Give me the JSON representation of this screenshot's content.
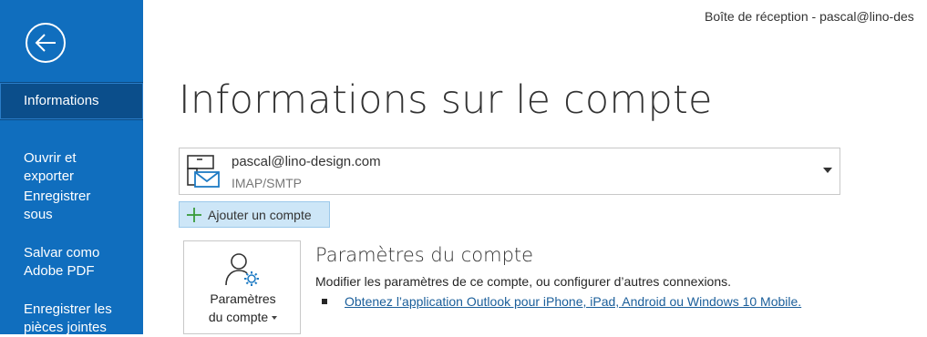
{
  "window": {
    "title": "Boîte de réception - pascal@lino-des"
  },
  "sidebar": {
    "back_icon": "back-arrow-icon",
    "items": [
      {
        "label": "Informations",
        "active": true
      },
      {
        "label": "Ouvrir et\nexporter"
      },
      {
        "label": "Enregistrer sous"
      },
      {
        "label": "Salvar como\nAdobe PDF"
      },
      {
        "label": "Enregistrer les\npièces jointes"
      }
    ]
  },
  "main": {
    "title": "Informations sur le compte",
    "account": {
      "email": "pascal@lino-design.com",
      "type": "IMAP/SMTP",
      "icon": "mail-account-icon"
    },
    "add_account_label": "Ajouter un compte",
    "settings_tile": {
      "line1": "Paramètres",
      "line2": "du compte",
      "icon": "user-gear-icon"
    },
    "settings_section": {
      "heading": "Paramètres du compte",
      "description": "Modifier les paramètres de ce compte, ou configurer d’autres connexions.",
      "link": "Obtenez l’application Outlook pour iPhone, iPad, Android ou Windows 10 Mobile."
    }
  },
  "colors": {
    "sidebar_bg": "#106ebe",
    "sidebar_active": "#0b4e8b",
    "add_button_bg": "#cde6f7",
    "link": "#1a5e9a"
  }
}
